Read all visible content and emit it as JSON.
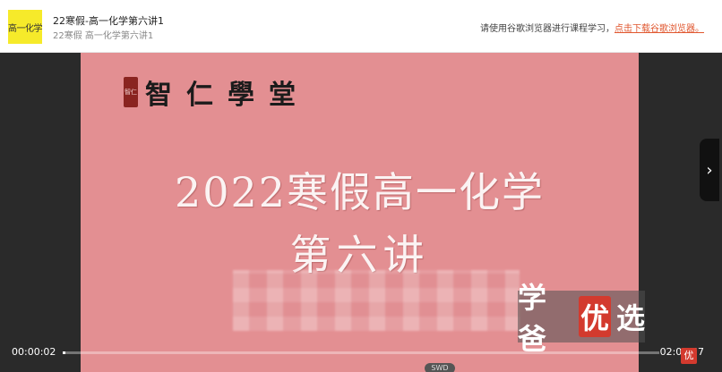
{
  "header": {
    "thumb_text": "高一化学",
    "title": "22寒假-高一化学第六讲1",
    "subtitle": "22寒假 高一化学第六讲1",
    "notice_text": "请使用谷歌浏览器进行课程学习，",
    "notice_link": "点击下载谷歌浏览器。"
  },
  "slide": {
    "seal_text": "智仁",
    "logo_text": "智仁學堂",
    "title_line1": "2022寒假高一化学",
    "title_line2": "第六讲"
  },
  "watermark": {
    "part1": "学爸",
    "highlight": "优",
    "part2": "选",
    "mini_logo": "优"
  },
  "player": {
    "current_time": "00:00:02",
    "total_time": "02:07:57",
    "progress_fraction": 0.0003,
    "badge": "SWD",
    "next_icon": "chevron-right-icon"
  },
  "colors": {
    "slide_bg": "#e38f92",
    "thumb_bg": "#f6ea2a",
    "link": "#e0562e",
    "player_bg": "#2a2a2a"
  }
}
